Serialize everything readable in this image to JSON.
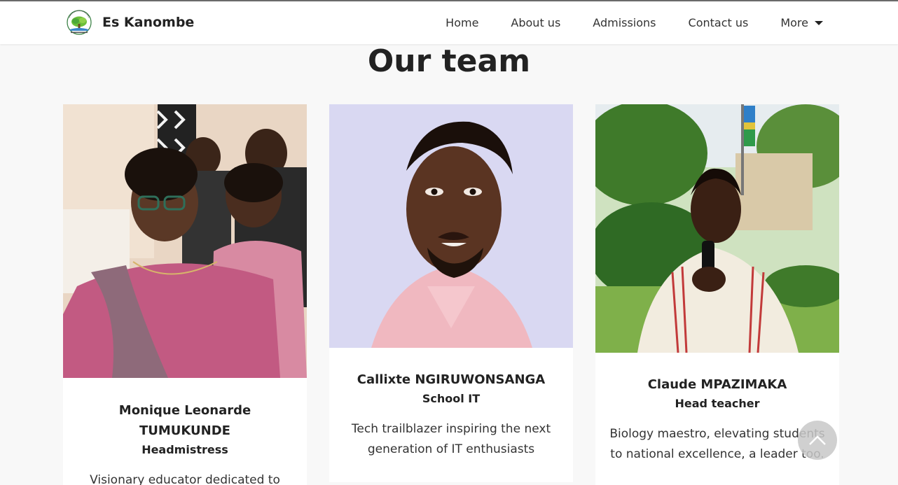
{
  "header": {
    "brand_name": "Es Kanombe",
    "logo_icon": "tree-logo-icon",
    "nav": [
      {
        "label": "Home"
      },
      {
        "label": "About us"
      },
      {
        "label": "Admissions"
      },
      {
        "label": "Contact us"
      },
      {
        "label": "More",
        "icon": "caret-down-icon"
      }
    ]
  },
  "main": {
    "title": "Our team",
    "team": [
      {
        "name": "Monique Leonarde TUMUKUNDE",
        "role": "Headmistress",
        "bio": "Visionary educator dedicated to"
      },
      {
        "name": "Callixte NGIRUWONSANGA",
        "role": "School IT",
        "bio": "Tech trailblazer inspiring the next generation of IT enthusiasts"
      },
      {
        "name": "Claude MPAZIMAKA",
        "role": "Head teacher",
        "bio": "Biology maestro, elevating students to national excellence, a leader too."
      }
    ]
  },
  "scroll_top": {
    "icon": "chevron-up-icon"
  },
  "colors": {
    "page_background": "#f8f8f8",
    "card_background": "#ffffff",
    "text": "#222222"
  }
}
